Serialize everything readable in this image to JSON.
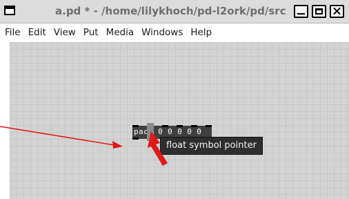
{
  "window": {
    "title": "a.pd * - /home/lilykhoch/pd-l2ork/pd/src"
  },
  "menu": {
    "items": [
      {
        "label": "File"
      },
      {
        "label": "Edit"
      },
      {
        "label": "View"
      },
      {
        "label": "Put"
      },
      {
        "label": "Media"
      },
      {
        "label": "Windows"
      },
      {
        "label": "Help"
      }
    ]
  },
  "canvas": {
    "object": {
      "text": "pack 0 0 0 0 0",
      "inlets": 6
    },
    "tooltip": "float symbol pointer"
  },
  "colors": {
    "canvas_bg": "#d3d3d3",
    "object_bg": "#404040",
    "tooltip_bg": "#2e2e2e",
    "annotation": "#e01818"
  },
  "icons": {
    "window": "app-window-icon",
    "minimize": "minimize-icon",
    "maximize": "maximize-icon",
    "close": "close-icon"
  }
}
